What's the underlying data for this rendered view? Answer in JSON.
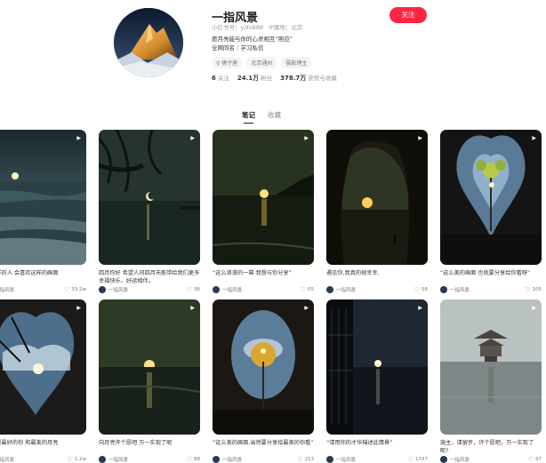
{
  "profile": {
    "name": "一指风景",
    "account_id": "小红书号：yzhi888",
    "ip_location": "IP属地：北京",
    "bio_line1": "愿月亮能与你的心灵相互“照应”",
    "bio_line2": "全网同名｜学习私信",
    "tags": [
      "♀ 狮子座",
      "北京通州",
      "摄影博主"
    ],
    "stats": [
      {
        "value": "6",
        "label": "关注"
      },
      {
        "value": "24.1万",
        "label": "粉丝"
      },
      {
        "value": "378.7万",
        "label": "获赞与收藏"
      }
    ],
    "follow_label": "关注"
  },
  "tabs": [
    {
      "label": "笔记"
    },
    {
      "label": "收藏"
    }
  ],
  "notes": [
    {
      "title": "什么样的人 会喜欢这样的画面",
      "author": "一指风景",
      "likes": "33.2w"
    },
    {
      "title": "四月你好 希望人间四月天能带给我们更多幸福快乐、好运相伴。",
      "author": "一指风景",
      "likes": "36"
    },
    {
      "title": "“这么浪漫的一幕 我想与你分享”",
      "author": "一指风景",
      "likes": "65"
    },
    {
      "title": "遇见你,我真的很幸幸.",
      "author": "一指风景",
      "likes": "56"
    },
    {
      "title": "“这么美的画面 也就要分享给你看呀”",
      "author": "一指风景",
      "likes": "105"
    },
    {
      "title": "只想要最好的你 和最美的月亮",
      "author": "一指风景",
      "likes": "1.2w"
    },
    {
      "title": "向月亮许个愿吧 万一实现了呢",
      "author": "一指风景",
      "likes": "88"
    },
    {
      "title": "“这么美的画面,当然要分享给最美的你看”",
      "author": "一指风景",
      "likes": "213"
    },
    {
      "title": "“请用你的才华描述此情景”",
      "author": "一指风景",
      "likes": "1337"
    },
    {
      "title": "施主，请留步，许个愿吧，万一实现了呢?",
      "author": "一指风景",
      "likes": "97"
    }
  ]
}
